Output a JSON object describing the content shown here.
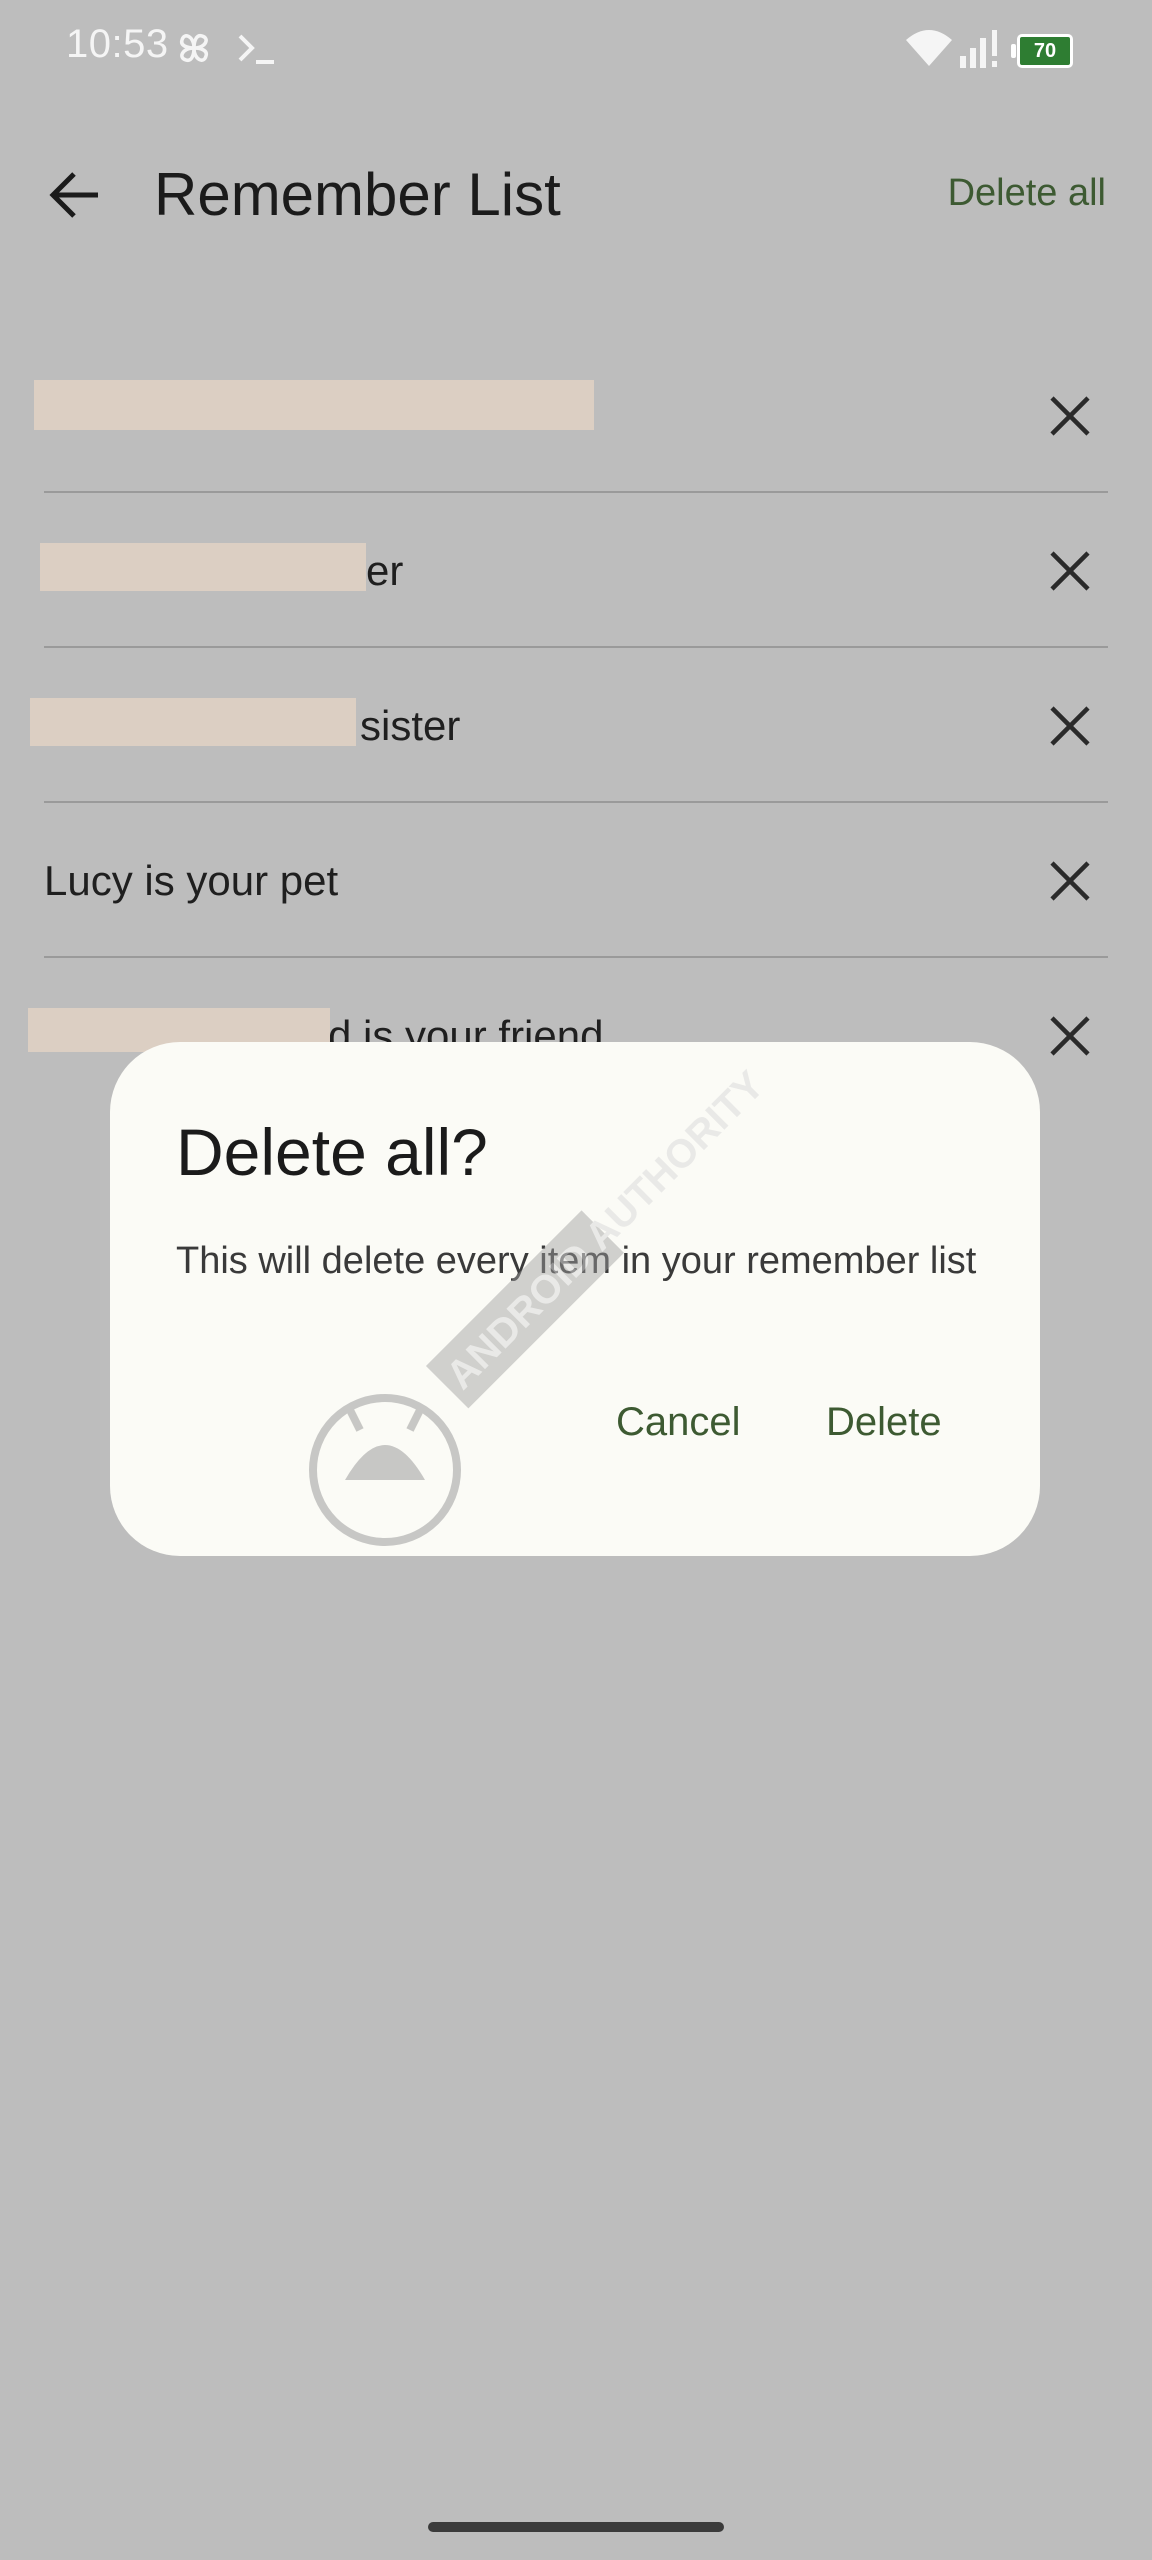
{
  "status_bar": {
    "time": "10:53",
    "battery": "70",
    "icons": [
      "pinwheel-icon",
      "terminal-icon",
      "wifi-icon",
      "signal-icon",
      "battery-charging-icon"
    ]
  },
  "app_bar": {
    "title": "Remember List",
    "back_icon": "arrow-back-icon",
    "action_label": "Delete all"
  },
  "list": {
    "items": [
      {
        "text": "",
        "remove_icon": "close-icon"
      },
      {
        "text": "er",
        "remove_icon": "close-icon"
      },
      {
        "text": "sister",
        "remove_icon": "close-icon"
      },
      {
        "text": "Lucy is your pet",
        "remove_icon": "close-icon"
      },
      {
        "text": "d is your friend",
        "remove_icon": "close-icon"
      }
    ]
  },
  "dialog": {
    "title": "Delete all?",
    "message": "This will delete every item in your remember list",
    "cancel_label": "Cancel",
    "confirm_label": "Delete"
  },
  "watermark": {
    "text": "ANDROID AUTHORITY"
  },
  "colors": {
    "scrim_background": "#bdbdbd",
    "dialog_background": "#fbfbf6",
    "accent_green": "#3d5a32",
    "redaction": "#dccfc3"
  }
}
